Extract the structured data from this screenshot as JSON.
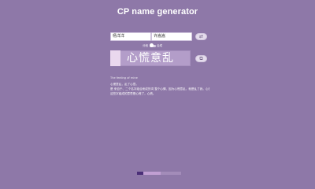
{
  "header": {
    "title": "CP name generator"
  },
  "inputs": {
    "first_name": "杨洋洋",
    "second_name": "许嵩嵩"
  },
  "buttons": {
    "swap_label": "⇄",
    "copy_label": "⧉"
  },
  "toggle": {
    "left_label": "分段",
    "right_label": "合成"
  },
  "result": {
    "name": "心慌意乱"
  },
  "description": {
    "title_line": "The feeling of mine",
    "lines": [
      "心慌意乱，乱了心意。",
      "是 来自于、二个名字组合而成的词 整个心情、因为心慌意乱，就是乱了我，心慌意乱。",
      "这些字组成的意思是心慌了，心慌。"
    ]
  },
  "colors": {
    "background": "#8e78a8",
    "result_box": "#b39dc9",
    "button": "#e4dcec"
  }
}
